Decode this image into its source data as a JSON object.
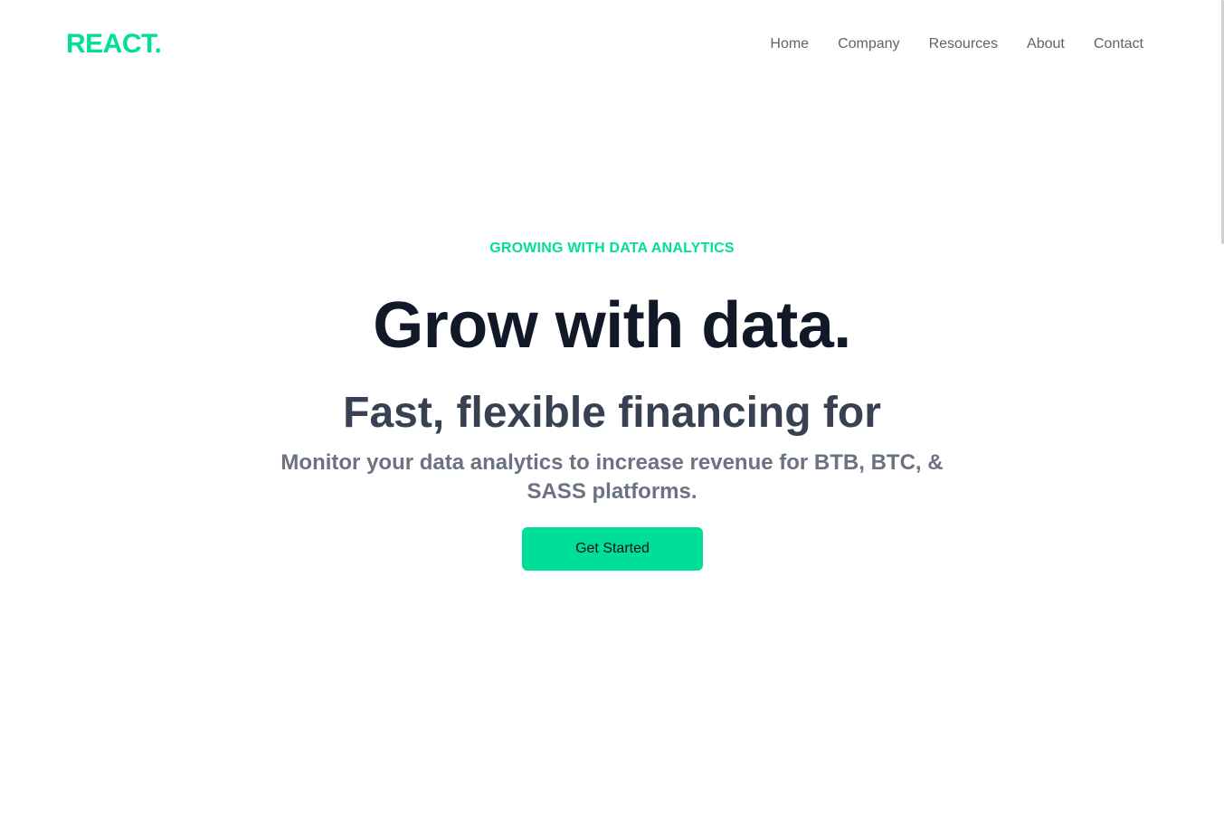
{
  "brand": {
    "logo_text": "REACT.",
    "accent_color": "#00df9a"
  },
  "nav": {
    "items": [
      {
        "label": "Home"
      },
      {
        "label": "Company"
      },
      {
        "label": "Resources"
      },
      {
        "label": "About"
      },
      {
        "label": "Contact"
      }
    ]
  },
  "hero": {
    "eyebrow": "GROWING WITH DATA ANALYTICS",
    "headline": "Grow with data.",
    "subheadline": "Fast, flexible financing for",
    "description": "Monitor your data analytics to increase revenue for BTB, BTC, & SASS platforms.",
    "cta_label": "Get Started"
  },
  "colors": {
    "headline": "#111827",
    "subheadline": "#374151",
    "description": "#6b7280",
    "nav_text": "#5b6470"
  }
}
